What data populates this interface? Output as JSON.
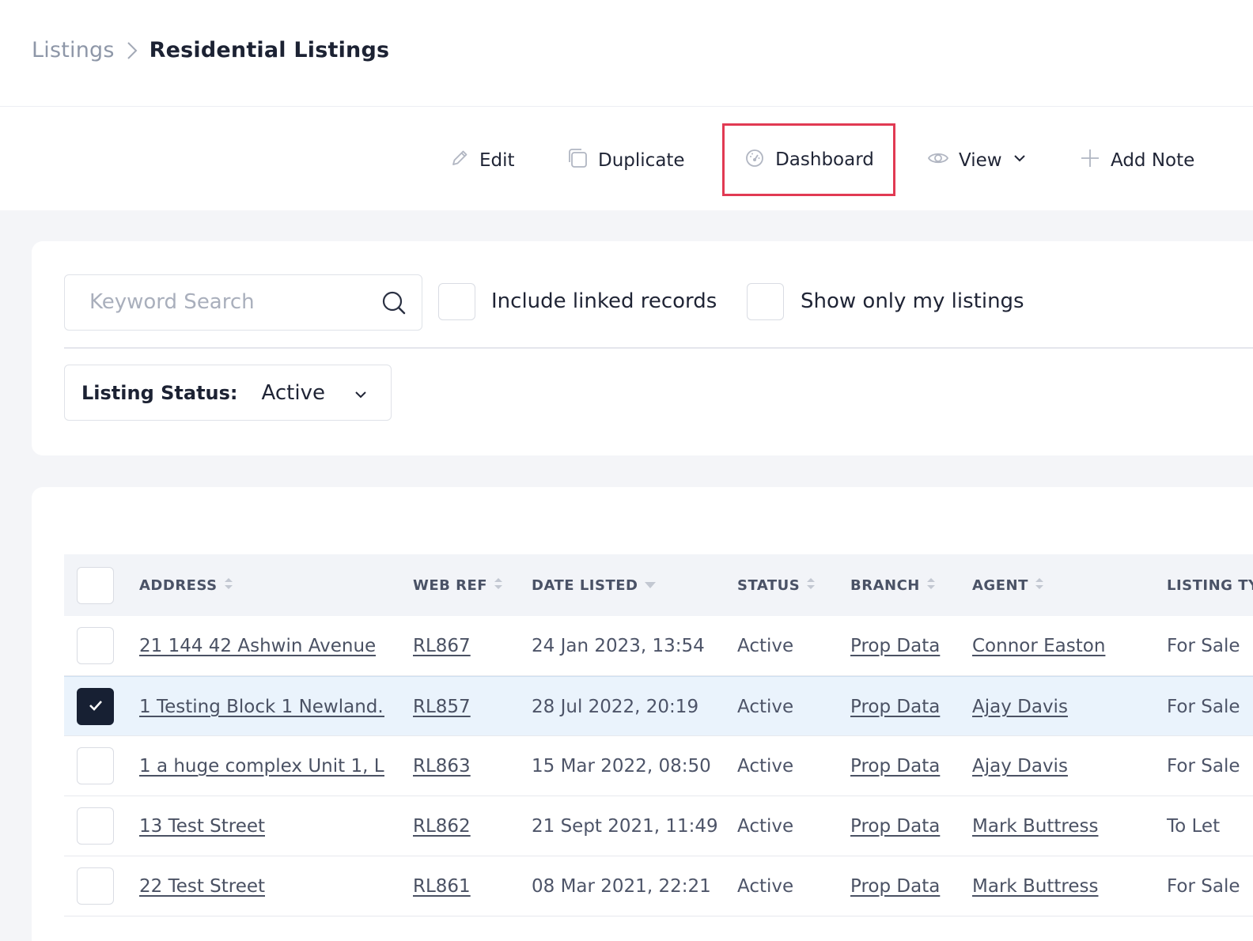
{
  "breadcrumb": {
    "parent": "Listings",
    "current": "Residential Listings"
  },
  "toolbar": {
    "edit": "Edit",
    "duplicate": "Duplicate",
    "dashboard": "Dashboard",
    "view": "View",
    "add_note": "Add Note"
  },
  "filters": {
    "search_placeholder": "Keyword Search",
    "search_value": "",
    "include_linked": {
      "label": "Include linked records",
      "checked": false
    },
    "only_mine": {
      "label": "Show only my listings",
      "checked": false
    },
    "status": {
      "label": "Listing Status:",
      "value": "Active"
    }
  },
  "table": {
    "columns": {
      "address": "ADDRESS",
      "web_ref": "WEB REF",
      "date_listed": "DATE LISTED",
      "status": "STATUS",
      "branch": "BRANCH",
      "agent": "AGENT",
      "listing_type": "LISTING TY"
    },
    "rows": [
      {
        "address": "21 144 42 Ashwin Avenue",
        "web_ref": "RL867",
        "date_listed": "24 Jan 2023, 13:54",
        "status": "Active",
        "branch": "Prop Data",
        "agent": "Connor Easton",
        "listing_type": "For Sale",
        "selected": false
      },
      {
        "address": "1 Testing Block 1 Newland...",
        "web_ref": "RL857",
        "date_listed": "28 Jul 2022, 20:19",
        "status": "Active",
        "branch": "Prop Data",
        "agent": "Ajay Davis",
        "listing_type": "For Sale",
        "selected": true
      },
      {
        "address": "1 a huge complex Unit 1, L...",
        "web_ref": "RL863",
        "date_listed": "15 Mar 2022, 08:50",
        "status": "Active",
        "branch": "Prop Data",
        "agent": "Ajay Davis",
        "listing_type": "For Sale",
        "selected": false
      },
      {
        "address": "13 Test Street",
        "web_ref": "RL862",
        "date_listed": "21 Sept 2021, 11:49",
        "status": "Active",
        "branch": "Prop Data",
        "agent": "Mark Buttress",
        "listing_type": "To Let",
        "selected": false
      },
      {
        "address": "22 Test Street",
        "web_ref": "RL861",
        "date_listed": "08 Mar 2021, 22:21",
        "status": "Active",
        "branch": "Prop Data",
        "agent": "Mark Buttress",
        "listing_type": "For Sale",
        "selected": false
      }
    ]
  },
  "colors": {
    "highlight": "#e13a53",
    "selected_row": "#eaf3fc",
    "checked_box": "#172033"
  },
  "icons": [
    "chevron-right-icon",
    "pencil-icon",
    "copy-icon",
    "dashboard-gauge-icon",
    "eye-icon",
    "chevron-down-icon",
    "plus-icon",
    "search-icon",
    "sort-icon",
    "checkmark-icon"
  ]
}
